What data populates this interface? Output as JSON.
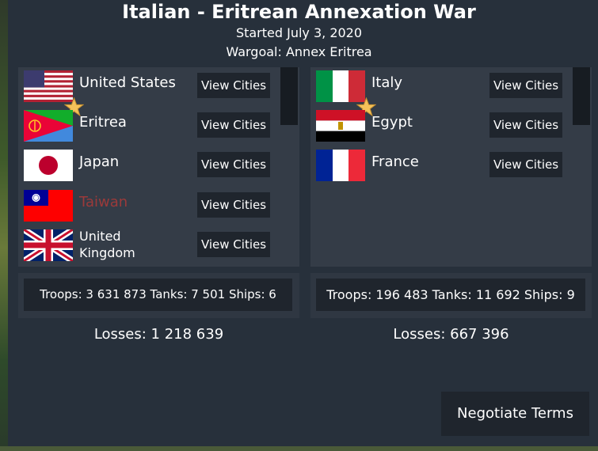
{
  "war": {
    "title": "Italian - Eritrean Annexation War",
    "started": "Started July 3, 2020",
    "wargoal": "Wargoal: Annex Eritrea"
  },
  "left_side": {
    "countries": [
      {
        "name": "United States",
        "flag": "flag-usa",
        "leader": true
      },
      {
        "name": "Eritrea",
        "flag": "flag-eritrea",
        "leader": false
      },
      {
        "name": "Japan",
        "flag": "flag-japan",
        "leader": false
      },
      {
        "name": "Taiwan",
        "flag": "flag-taiwan",
        "leader": false,
        "name_color": "#9b3a3a"
      },
      {
        "name": "United Kingdom",
        "flag": "flag-uk",
        "leader": false
      }
    ],
    "view_cities_label": "View Cities",
    "stats": "Troops: 3 631 873  Tanks: 7 501  Ships: 6",
    "losses": "Losses: 1 218 639"
  },
  "right_side": {
    "countries": [
      {
        "name": "Italy",
        "flag": "flag-italy",
        "leader": true
      },
      {
        "name": "Egypt",
        "flag": "flag-egypt",
        "leader": false
      },
      {
        "name": "France",
        "flag": "flag-france",
        "leader": false
      }
    ],
    "view_cities_label": "View Cities",
    "stats": "Troops: 196 483  Tanks: 11 692  Ships: 9",
    "losses": "Losses: 667 396"
  },
  "negotiate_label": "Negotiate Terms",
  "colors": {
    "background": "#27303b",
    "panel": "#343c47",
    "button": "#1f252d",
    "star": "#f4c25a"
  }
}
